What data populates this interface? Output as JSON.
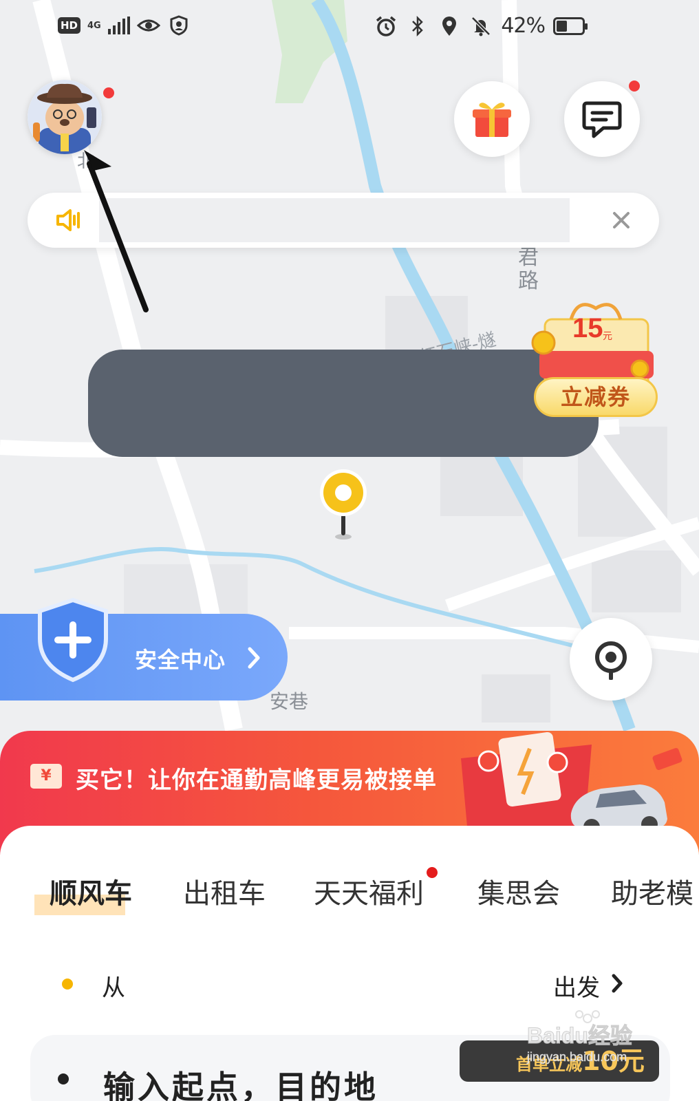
{
  "status_bar": {
    "network_badge": "HD",
    "network_type": "4G",
    "battery_text": "42%",
    "battery_level": 0.42,
    "icons": [
      "hd-icon",
      "signal-icon",
      "eye-icon",
      "vpn-shield-icon",
      "alarm-icon",
      "bluetooth-icon",
      "location-icon",
      "mute-icon",
      "battery-icon"
    ]
  },
  "map": {
    "road_vertical": "君路",
    "road_diagonal": "红石峡-燧",
    "road_left": "北",
    "alley": "安巷"
  },
  "top_controls": {
    "avatar_icon": "avatar-icon",
    "gift_icon": "gift-icon",
    "message_icon": "message-icon"
  },
  "notice": {
    "text": "",
    "speaker_icon": "speaker-icon",
    "close_icon": "close-icon"
  },
  "coupon": {
    "amount": "15",
    "unit": "元",
    "label": "立减券"
  },
  "safety": {
    "label": "安全中心",
    "icon": "shield-plus-icon"
  },
  "promo": {
    "ticket_glyph": "¥",
    "text": "买它！让你在通勤高峰更易被接单"
  },
  "tabs": [
    {
      "label": "顺风车",
      "active": true
    },
    {
      "label": "出租车",
      "active": false
    },
    {
      "label": "天天福利",
      "active": false,
      "badge": true
    },
    {
      "label": "集思会",
      "active": false
    },
    {
      "label": "助老模",
      "active": false
    }
  ],
  "route": {
    "from_label": "从",
    "depart_label": "出发",
    "destination_placeholder": "输入起点，目的地",
    "dest_promo_text": "首单立减",
    "dest_promo_amount": "10元"
  },
  "watermark": {
    "brand": "Baidu经验",
    "url": "jingyan.baidu.com"
  },
  "colors": {
    "accent_yellow": "#f6c21a",
    "safety_blue": "#6a9ef7",
    "promo_red": "#f1394d",
    "badge_red": "#f23b3b",
    "tooltip_grey": "#5a626e"
  }
}
